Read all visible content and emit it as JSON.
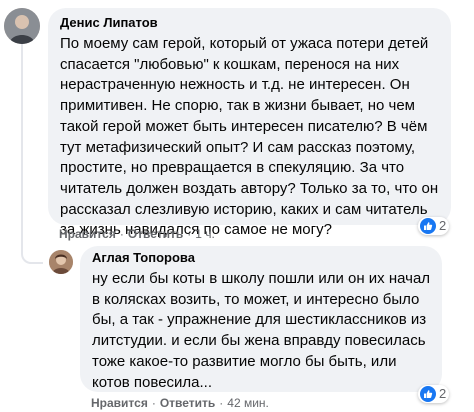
{
  "comments": [
    {
      "author": "Денис Липатов",
      "lines": [
        "По моему сам герой, который от ужаса потери детей",
        "спасается \"любовью\" к кошкам, перенося на них",
        "нерастраченную нежность и т.д. не интересен. Он",
        "примитивен. Не спорю, так в жизни бывает, но чем",
        "такой герой может быть интересен писателю? В чём",
        "тут метафизический опыт? И сам рассказ поэтому,",
        "простите, но превращается в спекуляцию. За что",
        "читатель должен воздать автору? Только за то, что он",
        "рассказал слезливую историю, каких и сам читатель",
        "за жизнь навидался по самое не могу?"
      ],
      "reaction_count": "2",
      "actions": {
        "like": "Нравится",
        "reply": "Ответить",
        "time": "1 ч."
      }
    },
    {
      "author": "Аглая Топорова",
      "lines": [
        "ну если бы коты в школу пошли или он их начал",
        "в колясках возить, то может, и интересно было",
        "бы, а так - упражнение для шестиклассников из",
        "литстудии. и если бы жена вправду повесилась",
        "тоже какое-то развитие могло бы быть, или",
        "котов повесила..."
      ],
      "reaction_count": "2",
      "actions": {
        "like": "Нравится",
        "reply": "Ответить",
        "time": "42 мин."
      }
    }
  ],
  "separator": "·",
  "icons": {
    "reaction": "like-icon",
    "avatar": "avatar"
  },
  "colors": {
    "like_blue": "#1877f2",
    "bubble": "#f0f2f5",
    "meta": "#65676b"
  }
}
